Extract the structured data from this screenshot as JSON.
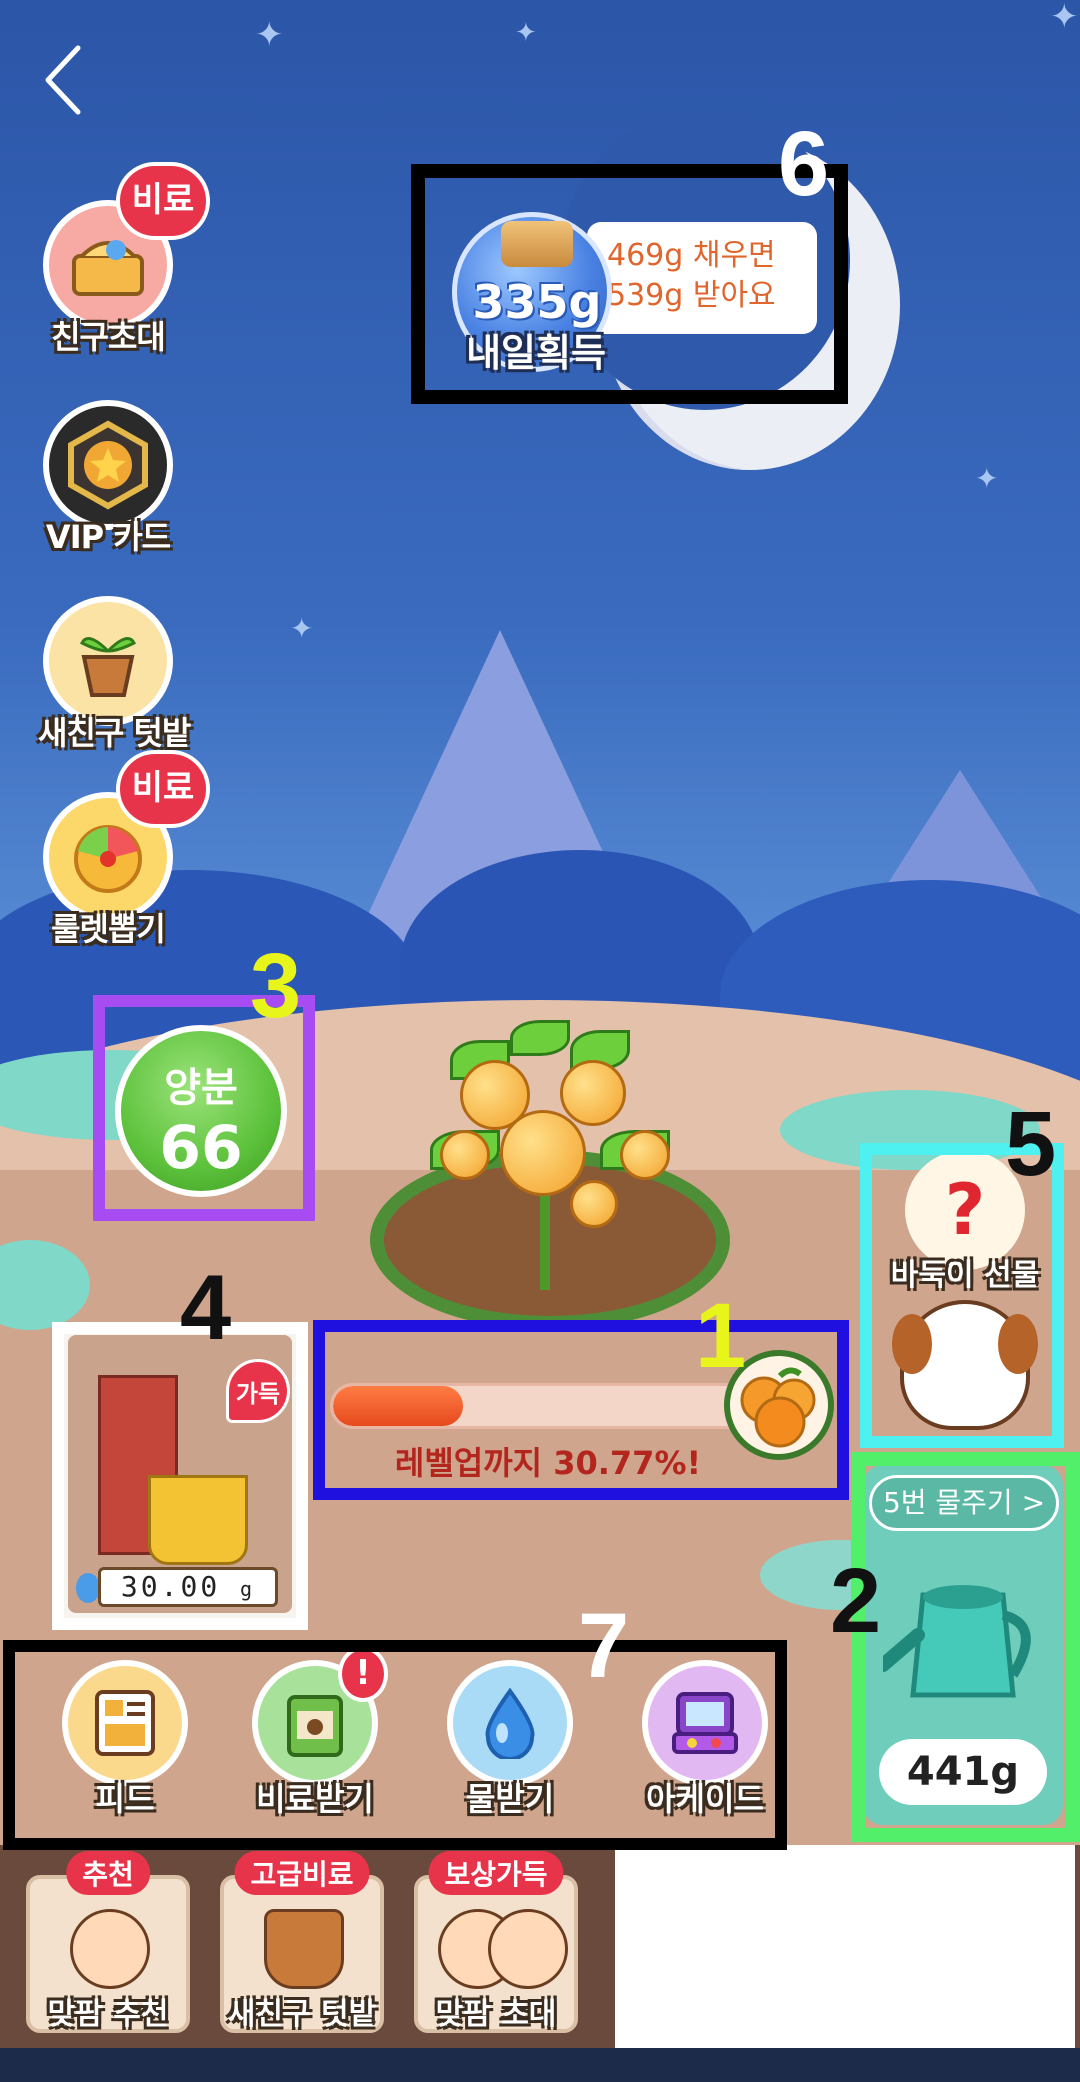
{
  "side_menu": {
    "invite": {
      "label": "친구초대",
      "badge": "비료"
    },
    "vip": {
      "label": "VIP 카드"
    },
    "new_friend_garden": {
      "label": "새친구 텃밭"
    },
    "roulette": {
      "label": "룰렛뽑기",
      "badge": "비료"
    }
  },
  "annotations": {
    "n1": "1",
    "n2": "2",
    "n3": "3",
    "n4": "4",
    "n5": "5",
    "n6": "6",
    "n7": "7"
  },
  "tomorrow": {
    "jar_value": "335g",
    "jar_label": "내일획득",
    "line1": "469g 채우면",
    "line2": "539g 받아요"
  },
  "nutrient": {
    "label": "양분",
    "value": "66"
  },
  "progress": {
    "percent": 30.77,
    "text": "레벨업까지 30.77%!"
  },
  "puppy": {
    "label": "바둑이 선물",
    "question": "?"
  },
  "watering": {
    "button_label": "5번 물주기 >",
    "amount": "441g"
  },
  "well": {
    "badge": "가득",
    "value": "30.00",
    "unit": "g"
  },
  "actions": [
    {
      "label": "피드"
    },
    {
      "label": "비료받기",
      "alert": "!"
    },
    {
      "label": "물받기"
    },
    {
      "label": "아케이드"
    }
  ],
  "bottom_cards": [
    {
      "label": "맞팜 추천",
      "badge": "추천"
    },
    {
      "label": "새친구 텃밭",
      "badge": "고급비료"
    },
    {
      "label": "맞팜 초대",
      "badge": "보상가득"
    }
  ],
  "colors": {
    "box1": "#2010e0",
    "box2": "#52f06a",
    "box3": "#a64cf2",
    "box4": "#ffffff",
    "box5": "#4ff0f0",
    "box6": "#000000",
    "box7": "#000000",
    "num1": "#e8f51a",
    "num3": "#e8f51a"
  }
}
